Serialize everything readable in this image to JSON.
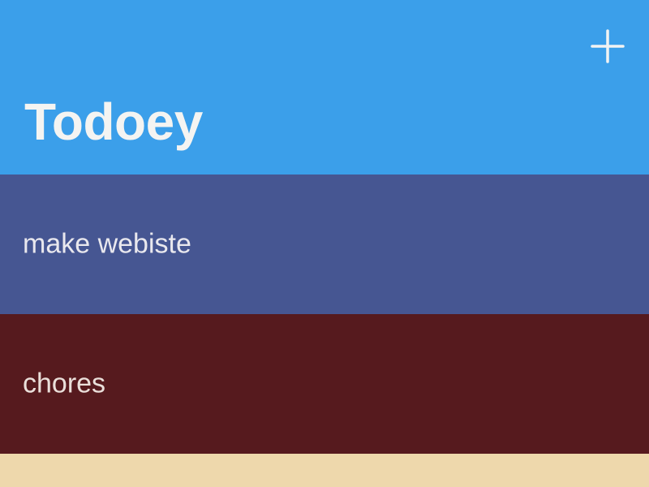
{
  "header": {
    "title": "Todoey",
    "background": "#3b9fea",
    "add_icon": "plus-icon"
  },
  "categories": [
    {
      "label": "make webiste",
      "color": "#465692"
    },
    {
      "label": "chores",
      "color": "#561a1e"
    },
    {
      "label": "",
      "color": "#eed8ac"
    }
  ]
}
